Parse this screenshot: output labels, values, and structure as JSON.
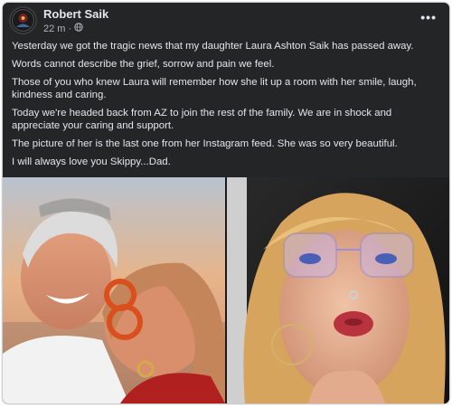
{
  "post": {
    "author": "Robert Saik",
    "time": "22 m",
    "separator": "·",
    "privacy_icon": "globe-icon",
    "more_icon": "more-options-icon",
    "paragraphs": [
      "Yesterday we got the tragic news that my daughter Laura Ashton Saik has passed away.",
      "Words cannot describe the grief, sorrow and pain we feel.",
      "Those of you who knew Laura will remember how she lit up a room with her smile, laugh, kindness and caring.",
      "Today we're headed back from AZ to join the rest of the family. We are in shock and appreciate your caring and support.",
      "The picture of her is the last one from her Instagram feed. She was so very beautiful.",
      "I will always love you Skippy...Dad."
    ]
  },
  "colors": {
    "card_bg": "#242526",
    "text_primary": "#e4e6eb",
    "text_secondary": "#b0b3b8"
  }
}
